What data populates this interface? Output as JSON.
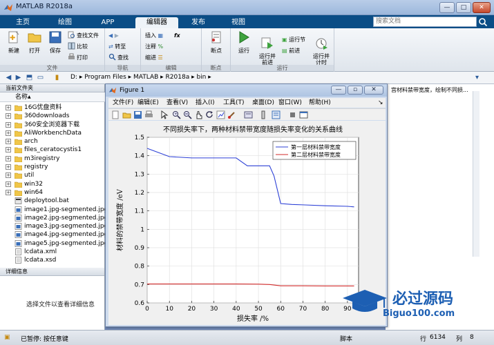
{
  "window": {
    "title": "MATLAB R2018a",
    "minimize": "—",
    "maximize": "□",
    "close": "✕"
  },
  "tabs": [
    {
      "label": "主页"
    },
    {
      "label": "绘图"
    },
    {
      "label": "APP"
    },
    {
      "label": "编辑器",
      "active": true
    },
    {
      "label": "发布"
    },
    {
      "label": "视图"
    }
  ],
  "search": {
    "placeholder": "搜索文档"
  },
  "ribbon": {
    "file": {
      "label": "文件",
      "new": "新建",
      "open": "打开",
      "save": "保存",
      "find_files": "查找文件",
      "compare": "比较",
      "print": "打印"
    },
    "nav": {
      "label": "导航",
      "goto": "转至",
      "find": "查找"
    },
    "edit": {
      "label": "编辑",
      "insert": "插入",
      "comment": "注释",
      "indent": "缩进",
      "fx": "fx"
    },
    "breakpoints": {
      "label": "断点",
      "btn": "断点"
    },
    "run": {
      "label": "运行",
      "run": "运行",
      "run_advance": "运行并\n前进",
      "run_section": "运行节",
      "advance": "前进",
      "run_time": "运行并\n计时"
    }
  },
  "addressbar": {
    "path": "D:  ▸  Program Files  ▸  MATLAB  ▸  R2018a  ▸  bin  ▸"
  },
  "current_folder": {
    "header": "当前文件夹",
    "column": "名称",
    "files": [
      {
        "name": "16G优盘资料",
        "type": "folder"
      },
      {
        "name": "360downloads",
        "type": "folder"
      },
      {
        "name": "360安全浏览器下载",
        "type": "folder"
      },
      {
        "name": "AliWorkbenchData",
        "type": "folder"
      },
      {
        "name": "arch",
        "type": "folder"
      },
      {
        "name": "files_ceratocystis1",
        "type": "folder"
      },
      {
        "name": "m3iregistry",
        "type": "folder"
      },
      {
        "name": "registry",
        "type": "folder"
      },
      {
        "name": "util",
        "type": "folder"
      },
      {
        "name": "win32",
        "type": "folder"
      },
      {
        "name": "win64",
        "type": "folder"
      },
      {
        "name": "deploytool.bat",
        "type": "bat"
      },
      {
        "name": "image1.jpg-segmented.jpg",
        "type": "img"
      },
      {
        "name": "image2.jpg-segmented.jpg",
        "type": "img"
      },
      {
        "name": "image3.jpg-segmented.jpg",
        "type": "img"
      },
      {
        "name": "image4.jpg-segmented.jpg",
        "type": "img"
      },
      {
        "name": "image5.jpg-segmented.jpg",
        "type": "img"
      },
      {
        "name": "lcdata.xml",
        "type": "doc"
      },
      {
        "name": "lcdata.xsd",
        "type": "doc"
      }
    ]
  },
  "details": {
    "header": "详细信息",
    "message": "选择文件以查看详细信息"
  },
  "command_window": {
    "text": "宫材料禁带宽度，绘制不同损..."
  },
  "statusbar": {
    "state": "已暂停: 按任意键",
    "mode": "脚本",
    "line_label": "行",
    "line": "6134",
    "col_label": "列",
    "col": "8"
  },
  "figure": {
    "title": "Figure 1",
    "menus": [
      "文件(F)",
      "编辑(E)",
      "查看(V)",
      "插入(I)",
      "工具(T)",
      "桌面(D)",
      "窗口(W)",
      "帮助(H)"
    ]
  },
  "chart_data": {
    "type": "line",
    "title": "不同损失率下，两种材料禁带宽度随损失率变化的关系曲线",
    "xlabel": "损失率 /%",
    "ylabel": "材料的禁带宽度 /eV",
    "xlim": [
      0,
      95
    ],
    "ylim": [
      0.6,
      1.5
    ],
    "xticks": [
      0,
      10,
      20,
      30,
      40,
      50,
      60,
      70,
      80,
      90
    ],
    "yticks": [
      0.6,
      0.7,
      0.8,
      0.9,
      1.0,
      1.1,
      1.2,
      1.3,
      1.4,
      1.5
    ],
    "ytick_labels": [
      "0.6",
      "0.7",
      "0.8",
      "0.9",
      "1",
      "1.1",
      "1.2",
      "1.3",
      "1.4",
      "1.5"
    ],
    "grid": true,
    "legend_position": "top-right",
    "series": [
      {
        "name": "第一层材料禁带宽度",
        "color": "#2b3fd6",
        "x": [
          0,
          10,
          20,
          30,
          40,
          45,
          55,
          57,
          60,
          65,
          70,
          80,
          90,
          93
        ],
        "y": [
          1.44,
          1.395,
          1.388,
          1.388,
          1.388,
          1.345,
          1.345,
          1.29,
          1.14,
          1.135,
          1.133,
          1.128,
          1.125,
          1.122
        ]
      },
      {
        "name": "第二层材料禁带宽度",
        "color": "#d12a2a",
        "x": [
          0,
          10,
          20,
          30,
          40,
          50,
          55,
          60,
          70,
          80,
          90,
          93
        ],
        "y": [
          0.703,
          0.703,
          0.703,
          0.703,
          0.703,
          0.702,
          0.7,
          0.693,
          0.693,
          0.692,
          0.692,
          0.692
        ]
      }
    ]
  },
  "watermark": {
    "brand": "必过源码",
    "url": "Biguo100.com"
  },
  "colors": {
    "tab_bar": "#0b4d86",
    "accent": "#2b3fd6"
  }
}
